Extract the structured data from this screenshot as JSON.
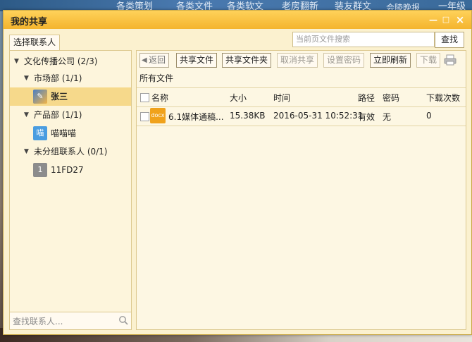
{
  "desktop": {
    "items": [
      "各类策划",
      "各类文件",
      "各类软文",
      "老房翻新",
      "装友群文",
      "会陵晚报",
      "一年级"
    ]
  },
  "window": {
    "title": "我的共享",
    "min": "—",
    "max": "□",
    "close": "×"
  },
  "tab": "选择联系人",
  "search": {
    "placeholder": "当前页文件搜索",
    "button": "查找"
  },
  "tree": {
    "company": "文化传播公司 (2/3)",
    "dept1": "市场部 (1/1)",
    "user1": "张三",
    "dept2": "产品部 (1/1)",
    "user2": "喵喵喵",
    "user2_avatar": "喵",
    "dept3": "未分组联系人 (0/1)",
    "user3": "11FD27",
    "user3_avatar": "1"
  },
  "left_search": {
    "placeholder": "查找联系人..."
  },
  "toolbar": {
    "back": "返回",
    "share_file": "共享文件",
    "share_folder": "共享文件夹",
    "cancel_share": "取消共享",
    "set_password": "设置密码",
    "refresh": "立即刷新",
    "download": "下载"
  },
  "breadcrumb": "所有文件",
  "table": {
    "headers": {
      "name": "名称",
      "size": "大小",
      "time": "时间",
      "path": "路径",
      "password": "密码",
      "downloads": "下载次数"
    },
    "rows": [
      {
        "icon": "docx",
        "name": "6.1媒体通稿...",
        "size": "15.38KB",
        "time": "2016-05-31 10:52:31",
        "path": "有效",
        "password": "无",
        "downloads": "0"
      }
    ]
  }
}
